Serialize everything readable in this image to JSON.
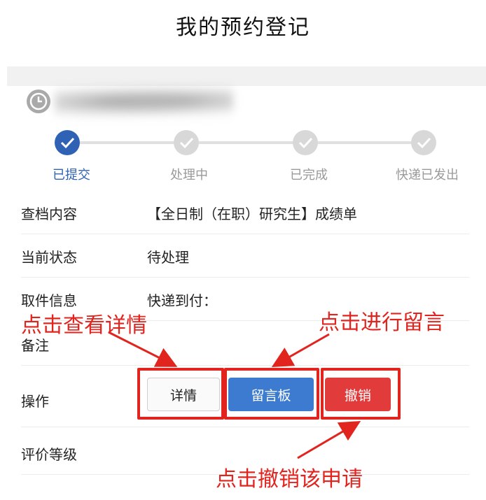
{
  "page": {
    "title": "我的预约登记"
  },
  "steps": [
    {
      "label": "已提交",
      "state": "done-active"
    },
    {
      "label": "处理中",
      "state": "pending"
    },
    {
      "label": "已完成",
      "state": "pending"
    },
    {
      "label": "快递已发出",
      "state": "pending"
    }
  ],
  "details": {
    "content_key": "查档内容",
    "content_val": "【全日制（在职）研究生】成绩单",
    "status_key": "当前状态",
    "status_val": "待处理",
    "pickup_key": "取件信息",
    "pickup_val": "快递到付：",
    "remark_key": "备注",
    "action_key": "操作",
    "rating_key": "评价等级"
  },
  "actions": {
    "detail_label": "详情",
    "message_label": "留言板",
    "cancel_label": "撤销"
  },
  "annotations": {
    "detail_hint": "点击查看详情",
    "message_hint": "点击进行留言",
    "cancel_hint": "点击撤销该申请"
  },
  "colors": {
    "primary": "#2f62b5",
    "message_button": "#3d7bd0",
    "cancel_button": "#e23b3b",
    "annotation_red": "#e2241f"
  }
}
